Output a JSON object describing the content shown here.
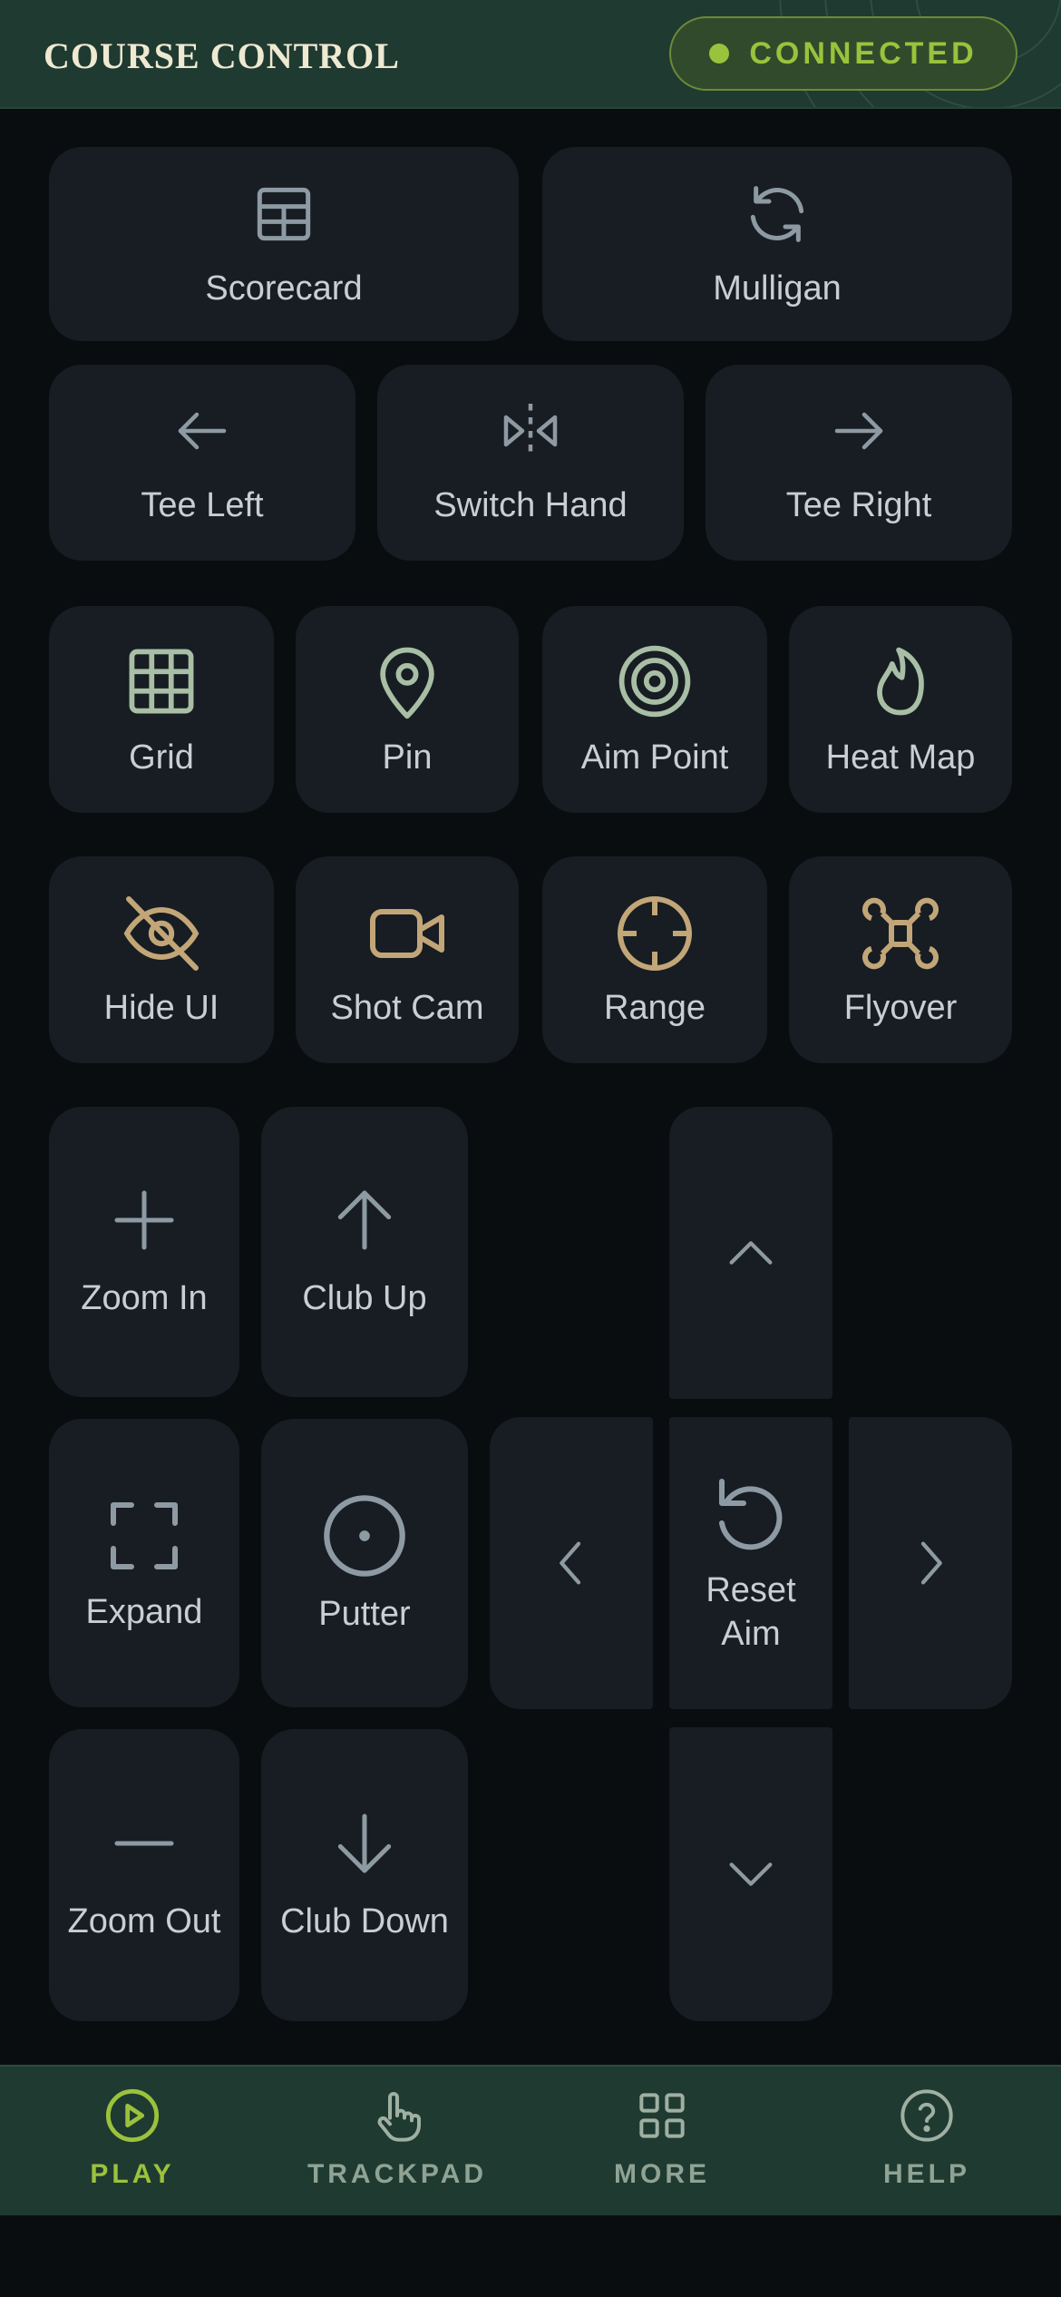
{
  "header": {
    "title": "COURSE CONTROL",
    "status": {
      "text": "CONNECTED",
      "color": "#9bc23c"
    }
  },
  "row1": [
    {
      "label": "Scorecard",
      "icon": "table-icon"
    },
    {
      "label": "Mulligan",
      "icon": "refresh-icon"
    }
  ],
  "row2": [
    {
      "label": "Tee Left",
      "icon": "arrow-left-icon"
    },
    {
      "label": "Switch Hand",
      "icon": "flip-horizontal-icon"
    },
    {
      "label": "Tee Right",
      "icon": "arrow-right-icon"
    }
  ],
  "row3": [
    {
      "label": "Grid",
      "icon": "grid-icon"
    },
    {
      "label": "Pin",
      "icon": "map-pin-icon"
    },
    {
      "label": "Aim Point",
      "icon": "target-icon"
    },
    {
      "label": "Heat Map",
      "icon": "flame-icon"
    }
  ],
  "row4": [
    {
      "label": "Hide UI",
      "icon": "eye-off-icon"
    },
    {
      "label": "Shot Cam",
      "icon": "video-camera-icon"
    },
    {
      "label": "Range",
      "icon": "crosshair-icon"
    },
    {
      "label": "Flyover",
      "icon": "drone-icon"
    }
  ],
  "controls": {
    "zoom_in": "Zoom In",
    "club_up": "Club Up",
    "expand": "Expand",
    "putter": "Putter",
    "zoom_out": "Zoom Out",
    "club_down": "Club Down",
    "reset_aim_line1": "Reset",
    "reset_aim_line2": "Aim"
  },
  "tabs": [
    {
      "label": "PLAY",
      "icon": "play-circle-icon",
      "active": true
    },
    {
      "label": "TRACKPAD",
      "icon": "hand-pointer-icon",
      "active": false
    },
    {
      "label": "MORE",
      "icon": "apps-grid-icon",
      "active": false
    },
    {
      "label": "HELP",
      "icon": "help-circle-icon",
      "active": false
    }
  ],
  "colors": {
    "header_bg": "#1f3a31",
    "accent": "#9bc23c",
    "tile_bg": "#171d22",
    "page_bg": "#0a0d0f"
  }
}
